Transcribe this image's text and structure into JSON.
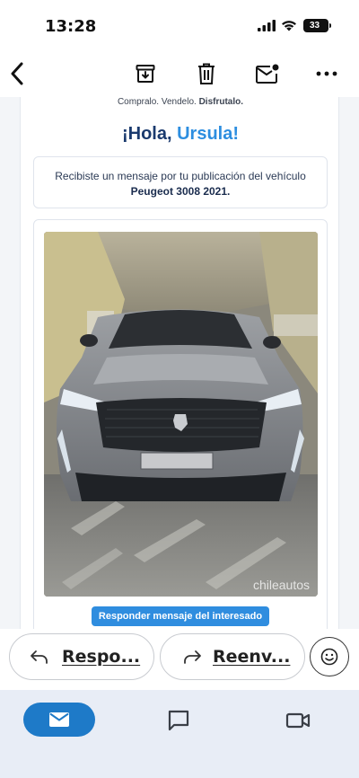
{
  "status_bar": {
    "time": "13:28",
    "battery": "33"
  },
  "toolbar": {
    "back_icon": "chevron-left-icon",
    "archive_icon": "archive-icon",
    "delete_icon": "trash-icon",
    "unread_icon": "mail-unread-icon",
    "more_icon": "more-horizontal-icon"
  },
  "email": {
    "tagline_prefix": "Compralo. Vendelo. ",
    "tagline_bold": "Disfrutalo.",
    "greeting_prefix": "¡Hola, ",
    "greeting_name": "Ursula!",
    "message_line1": "Recibiste un mensaje por tu publicación del vehículo",
    "message_car": "Peugeot 3008 2021.",
    "photo_watermark": "chileautos",
    "reply_button": "Responder mensaje del interesado"
  },
  "reply_bar": {
    "reply_label": "Respo...",
    "forward_label": "Reenv...",
    "emoji_icon": "emoji-smile-icon"
  },
  "bottom_nav": {
    "mail_icon": "mail-icon",
    "chat_icon": "chat-icon",
    "meet_icon": "video-icon"
  },
  "colors": {
    "accent": "#2f8ddf",
    "heading": "#1a3a6e",
    "nav_active": "#1e7ac8"
  }
}
